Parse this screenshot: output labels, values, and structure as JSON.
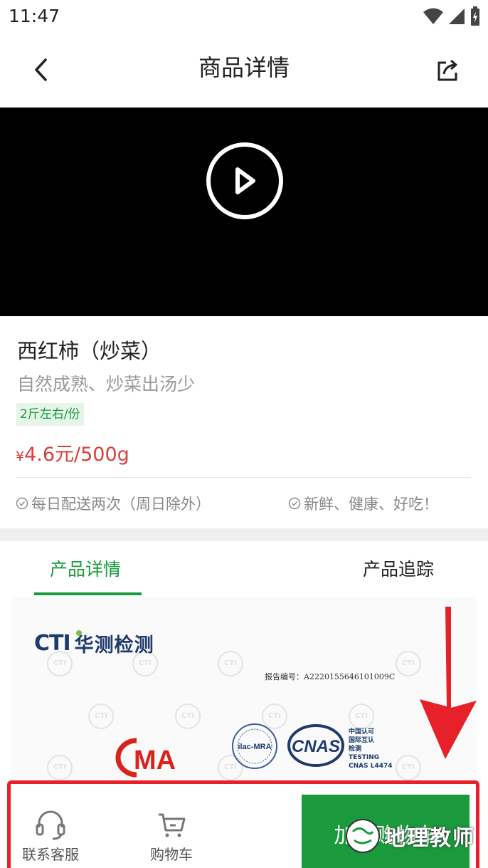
{
  "status_bar": {
    "time": "11:47"
  },
  "nav": {
    "title": "商品详情"
  },
  "product": {
    "name": "西红柿（炒菜）",
    "subtitle": "自然成熟、炒菜出汤少",
    "tag": "2斤左右/份",
    "price_symbol": "¥",
    "price": "4.6元/500g",
    "features": [
      "每日配送两次（周日除外）",
      "新鲜、健康、好吃！"
    ]
  },
  "tabs": [
    "产品详情",
    "产品追踪"
  ],
  "certificate": {
    "brand_latin": "CTI",
    "brand_cn": "华测检测",
    "report_no": "报告编号：A2220155646101009C",
    "cma": "MA",
    "ilac": "ilac-MRA",
    "cnas": "CNAS",
    "cnas_lines": [
      "中国认可",
      "国际互认",
      "检测",
      "TESTING",
      "CNAS L4474"
    ],
    "watermark": "CTI"
  },
  "bottom_bar": {
    "service_label": "联系客服",
    "cart_label": "购物车",
    "add_to_cart_label": "加入购物车"
  },
  "overlay_watermark": "地理教师",
  "colors": {
    "accent": "#1a9a3c",
    "price": "#d9403a",
    "highlight": "#e8202a"
  }
}
